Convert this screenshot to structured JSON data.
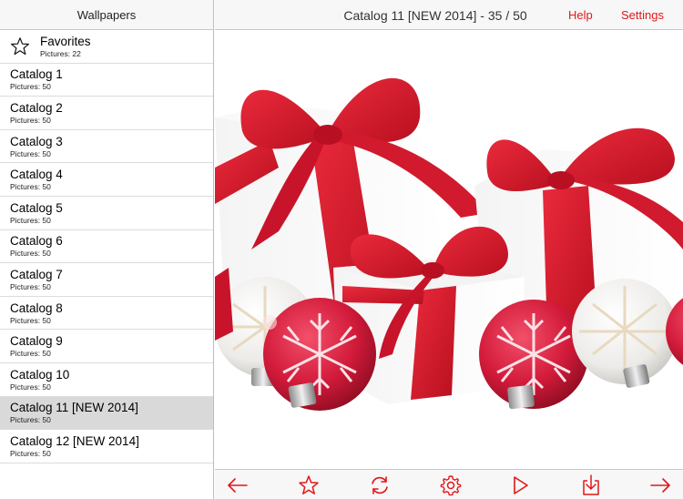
{
  "sidebar": {
    "title": "Wallpapers",
    "favorites": {
      "label": "Favorites",
      "sub": "Pictures: 22"
    },
    "items": [
      {
        "label": "Catalog 1",
        "sub": "Pictures: 50"
      },
      {
        "label": "Catalog 2",
        "sub": "Pictures: 50"
      },
      {
        "label": "Catalog 3",
        "sub": "Pictures: 50"
      },
      {
        "label": "Catalog 4",
        "sub": "Pictures: 50"
      },
      {
        "label": "Catalog 5",
        "sub": "Pictures: 50"
      },
      {
        "label": "Catalog 6",
        "sub": "Pictures: 50"
      },
      {
        "label": "Catalog 7",
        "sub": "Pictures: 50"
      },
      {
        "label": "Catalog 8",
        "sub": "Pictures: 50"
      },
      {
        "label": "Catalog 9",
        "sub": "Pictures: 50"
      },
      {
        "label": "Catalog 10",
        "sub": "Pictures: 50"
      },
      {
        "label": "Catalog 11 [NEW 2014]",
        "sub": "Pictures: 50"
      },
      {
        "label": "Catalog 12 [NEW 2014]",
        "sub": "Pictures: 50"
      }
    ],
    "selected_index": 10
  },
  "header": {
    "title": "Catalog 11 [NEW 2014] - 35 / 50",
    "help_label": "Help",
    "settings_label": "Settings"
  },
  "toolbar": {
    "icons": [
      "arrow-left-icon",
      "star-icon",
      "refresh-icon",
      "gear-icon",
      "play-icon",
      "download-icon",
      "arrow-right-icon"
    ]
  },
  "colors": {
    "accent": "#e3161a",
    "selected_row": "#d9d9d9",
    "bar_bg": "#f7f7f7"
  }
}
